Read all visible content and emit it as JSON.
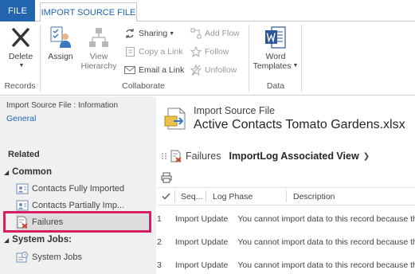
{
  "tabs": {
    "file": "FILE",
    "import_source_file": "IMPORT SOURCE FILE"
  },
  "ribbon": {
    "records": {
      "delete_label": "Delete",
      "group_label": "Records"
    },
    "collaborate": {
      "assign_label": "Assign",
      "view_hierarchy_line1": "View",
      "view_hierarchy_line2": "Hierarchy",
      "sharing_label": "Sharing",
      "copy_link_label": "Copy a Link",
      "email_link_label": "Email a Link",
      "add_flow_label": "Add Flow",
      "follow_label": "Follow",
      "unfollow_label": "Unfollow",
      "group_label": "Collaborate"
    },
    "data": {
      "word_templates_line1": "Word",
      "word_templates_line2": "Templates",
      "group_label": "Data"
    }
  },
  "left_nav": {
    "context_label": "Import Source File : Information",
    "general_link": "General",
    "related_heading": "Related",
    "common_group": {
      "label": "Common",
      "items": [
        {
          "label": "Contacts Fully Imported"
        },
        {
          "label": "Contacts Partially Imp..."
        },
        {
          "label": "Failures"
        }
      ]
    },
    "system_jobs_group": {
      "label": "System Jobs:",
      "items": [
        {
          "label": "System Jobs"
        }
      ]
    }
  },
  "main": {
    "entity_type": "Import Source File",
    "record_title": "Active Contacts Tomato Gardens.xlsx",
    "subgrid": {
      "entity_label": "Failures",
      "view_name": "ImportLog Associated View"
    },
    "grid": {
      "columns": {
        "sequence": "Seq...",
        "log_phase": "Log Phase",
        "description": "Description"
      },
      "rows": [
        {
          "seq": "1",
          "phase": "Import Update",
          "description": "You cannot import data to this record because the record was updated"
        },
        {
          "seq": "2",
          "phase": "Import Update",
          "description": "You cannot import data to this record because the record was updated"
        },
        {
          "seq": "3",
          "phase": "Import Update",
          "description": "You cannot import data to this record because the record was updated"
        }
      ]
    }
  },
  "colors": {
    "brand_blue": "#2264ae",
    "highlight_pink": "#d71e62",
    "nav_background": "#f0f0f0"
  }
}
